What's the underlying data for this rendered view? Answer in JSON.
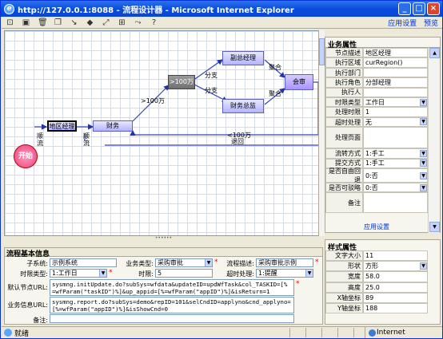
{
  "window": {
    "title": "http://127.0.0.1:8088 - 流程设计器 - Microsoft Internet Explorer"
  },
  "toolbar": {
    "icons": [
      "select-icon",
      "save-icon",
      "delete-icon",
      "copy-icon",
      "line-icon",
      "node-icon",
      "zoom-fit-icon",
      "zoom-icon",
      "trace-icon",
      "help-icon"
    ],
    "app_settings": "应用设置",
    "preview": "预览"
  },
  "diagram": {
    "start": "开始",
    "nodes": {
      "region_manager": "地区经理",
      "finance": "财务",
      "gt100": ">100万",
      "deputy_gm": "副总经理",
      "finance_director": "财务总监",
      "countersign": "会审"
    },
    "edge_labels": {
      "flow1": "顺流",
      "flow2": "顺流",
      "gt100w": ">100万",
      "branch1": "分支",
      "branch2": "分支",
      "agg1": "聚合",
      "agg2": "聚合",
      "lt100w": "<100万",
      "reject": "退回"
    }
  },
  "business_props": {
    "title": "业务属性",
    "rows": [
      {
        "label": "节点描述",
        "value": "地区经理",
        "dropdown": false
      },
      {
        "label": "执行区域",
        "value": "curRegion()",
        "dropdown": false
      },
      {
        "label": "执行部门",
        "value": "",
        "dropdown": false
      },
      {
        "label": "执行角色",
        "value": "分部经理",
        "dropdown": false
      },
      {
        "label": "执行人",
        "value": "",
        "dropdown": false
      },
      {
        "label": "时限类型",
        "value": "工作日",
        "dropdown": true
      },
      {
        "label": "处理时限",
        "value": "1",
        "dropdown": false
      },
      {
        "label": "超时处理",
        "value": "无",
        "dropdown": true
      },
      {
        "label": "处理页面",
        "value": "",
        "dropdown": false
      },
      {
        "label": "流转方式",
        "value": "1:手工",
        "dropdown": true
      },
      {
        "label": "提交方式",
        "value": "1:手工",
        "dropdown": true
      },
      {
        "label": "是否自由回退",
        "value": "0:否",
        "dropdown": true
      },
      {
        "label": "是否可驳略",
        "value": "0:否",
        "dropdown": true
      },
      {
        "label": "备注",
        "value": "",
        "dropdown": false
      }
    ],
    "apply": "应用设置"
  },
  "style_props": {
    "title": "样式属性",
    "rows": [
      {
        "label": "文字大小",
        "value": "11",
        "dropdown": false
      },
      {
        "label": "形状",
        "value": "方形",
        "dropdown": true
      },
      {
        "label": "宽度",
        "value": "58.0",
        "dropdown": false
      },
      {
        "label": "高度",
        "value": "25.0",
        "dropdown": false
      },
      {
        "label": "X轴坐标",
        "value": "89",
        "dropdown": false
      },
      {
        "label": "Y轴坐标",
        "value": "188",
        "dropdown": false
      }
    ]
  },
  "flow_basic": {
    "title": "流程基本信息",
    "subsystem_label": "子系统:",
    "subsystem_value": "示例系统",
    "biztype_label": "业务类型:",
    "biztype_value": "采购审批",
    "flowdesc_label": "流程描述:",
    "flowdesc_value": "采购审批示例",
    "timetype_label": "时限类型:",
    "timetype_value": "1:工作日",
    "timelimit_label": "时限:",
    "timelimit_value": "5",
    "timeout_label": "超时处理:",
    "timeout_value": "1:提醒",
    "default_url_label": "默认节点URL:",
    "default_url_value": "sysmng.initUpdate.do?subSys=wfdata&updateID=updWfTask&col_TASKID=[%\n=wfParam(\"taskID\")%]&up_appid=[%=wfParam(\"appID\")%]&isReturn=1",
    "biz_url_label": "业务信息URL:",
    "biz_url_value": "sysmng.report.do?subSys=demo&repID=101&selCndID=applyno&cnd_applyno=\n[%=wfParam(\"appID\")%]&isShowCnd=0",
    "remark_label": "备注:",
    "remark_value": ""
  },
  "status": {
    "text": "就绪",
    "zone": "Internet"
  }
}
